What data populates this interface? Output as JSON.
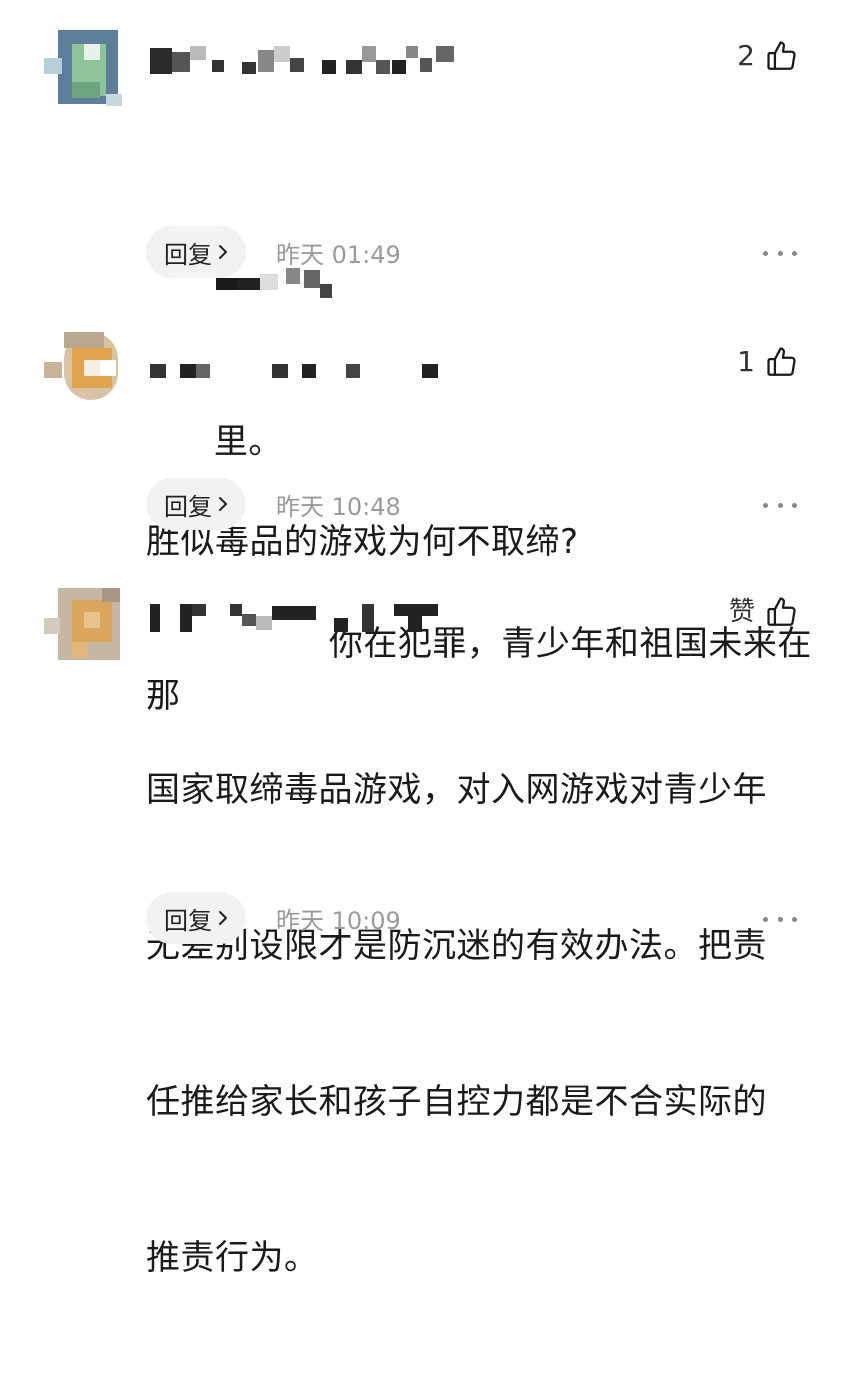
{
  "comments": [
    {
      "like_count": "2",
      "content_visible": "你在犯罪，青少年和祖国未来在那里。",
      "content_line1": "你在犯罪，青少年和祖国未来在那",
      "content_line2": "里。",
      "reply_label": "回复",
      "time": "昨天 01:49"
    },
    {
      "like_count": "1",
      "content": "胜似毒品的游戏为何不取缔?",
      "reply_label": "回复",
      "time": "昨天 10:48"
    },
    {
      "like_count": "赞",
      "content_lines": [
        "国家取缔毒品游戏，对入网游戏对青少年",
        "无差别设限才是防沉迷的有效办法。把责",
        "任推给家长和孩子自控力都是不合实际的",
        "推责行为。"
      ],
      "reply_label": "回复",
      "time": "昨天 10:09"
    }
  ],
  "icons": {
    "like": "thumbs-up-icon",
    "reply_chevron": "chevron-right-icon",
    "more": "more-dots-icon"
  }
}
